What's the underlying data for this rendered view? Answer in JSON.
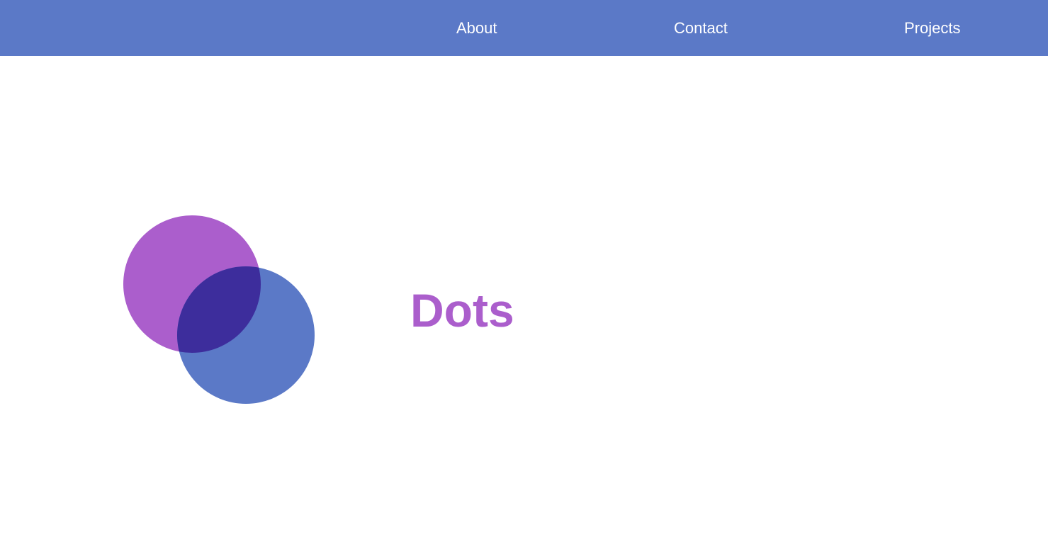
{
  "nav": {
    "items": [
      {
        "label": "About"
      },
      {
        "label": "Contact"
      },
      {
        "label": "Projects"
      }
    ]
  },
  "hero": {
    "title": "Dots"
  },
  "colors": {
    "navbar": "#5b79c7",
    "nav_text": "#ffffff",
    "title": "#ab5ecc",
    "circle_purple": "#ab5ecc",
    "circle_blue": "#5b79c7",
    "circle_overlap": "#3d2d9c"
  }
}
